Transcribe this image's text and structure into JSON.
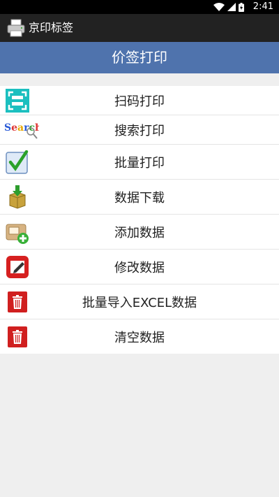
{
  "status_bar": {
    "time": "2:41"
  },
  "app": {
    "title": "京印标签"
  },
  "page": {
    "title": "价签打印"
  },
  "menu": {
    "items": [
      {
        "label": "扫码打印",
        "icon": "scan-icon"
      },
      {
        "label": "搜索打印",
        "icon": "search-icon"
      },
      {
        "label": "批量打印",
        "icon": "checkbox-icon"
      },
      {
        "label": "数据下载",
        "icon": "download-box-icon"
      },
      {
        "label": "添加数据",
        "icon": "add-data-icon"
      },
      {
        "label": "修改数据",
        "icon": "edit-icon"
      },
      {
        "label": "批量导入EXCEL数据",
        "icon": "trash-icon"
      },
      {
        "label": "清空数据",
        "icon": "trash-icon"
      }
    ]
  },
  "colors": {
    "header": "#4f73ad",
    "actionbar": "#222222",
    "background": "#efefef"
  }
}
